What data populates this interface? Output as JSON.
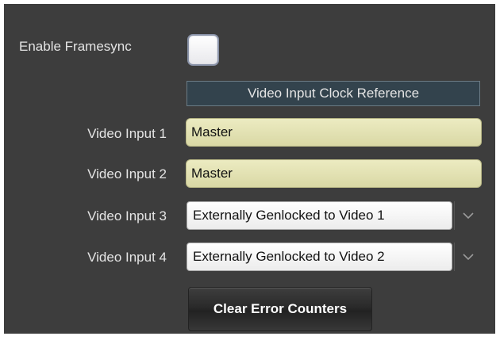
{
  "framesync": {
    "label": "Enable Framesync",
    "checked": false
  },
  "section_header": "Video Input Clock Reference",
  "inputs": [
    {
      "label": "Video Input 1",
      "value": "Master"
    },
    {
      "label": "Video Input 2",
      "value": "Master"
    },
    {
      "label": "Video Input 3",
      "value": "Externally Genlocked to Video 1"
    },
    {
      "label": "Video Input 4",
      "value": "Externally Genlocked to Video 2"
    }
  ],
  "clear_button_label": "Clear Error Counters",
  "icons": {
    "dropdown": "chevron-down-icon"
  },
  "colors": {
    "panel_bg": "#3d3d3d",
    "readonly_field": "#e3e2b3",
    "header_bg": "#33434d"
  }
}
